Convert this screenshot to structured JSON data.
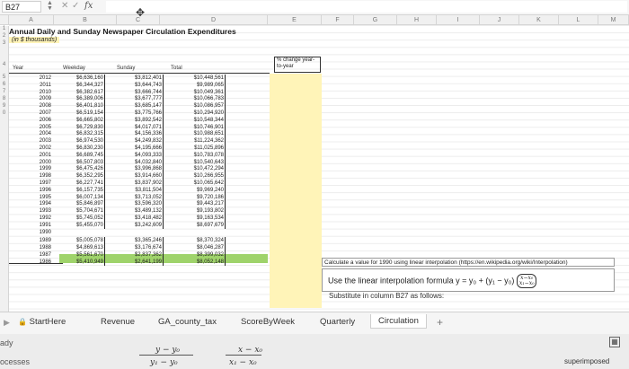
{
  "formula_bar": {
    "cell_ref": "B27",
    "fx": "fx",
    "cancel": "✕",
    "enter": "✓"
  },
  "columns": [
    "A",
    "B",
    "C",
    "D",
    "E",
    "F",
    "G",
    "H",
    "I",
    "J",
    "K",
    "L",
    "M"
  ],
  "rows": [
    "1",
    "2",
    "3",
    "4",
    "5",
    "6",
    "7",
    "8",
    "9",
    "0"
  ],
  "title": "Annual Daily and Sunday Newspaper Circulation Expenditures",
  "subtitle": "(in $ thousands)",
  "headers": {
    "year": "Year",
    "weekday": "Weekday",
    "sunday": "Sunday",
    "total": "Total",
    "pct": "% change year-to-year"
  },
  "table": [
    {
      "year": "2012",
      "weekday": "$6,636,160",
      "sunday": "$3,812,401",
      "total": "$10,448,561"
    },
    {
      "year": "2011",
      "weekday": "$6,344,327",
      "sunday": "$3,644,743",
      "total": "$9,989,065"
    },
    {
      "year": "2010",
      "weekday": "$6,382,617",
      "sunday": "$3,666,744",
      "total": "$10,049,361"
    },
    {
      "year": "2009",
      "weekday": "$6,389,006",
      "sunday": "$3,677,777",
      "total": "$10,066,783"
    },
    {
      "year": "2008",
      "weekday": "$6,401,810",
      "sunday": "$3,685,147",
      "total": "$10,086,957"
    },
    {
      "year": "2007",
      "weekday": "$6,519,154",
      "sunday": "$3,775,766",
      "total": "$10,294,920"
    },
    {
      "year": "2006",
      "weekday": "$6,665,802",
      "sunday": "$3,892,542",
      "total": "$10,548,344"
    },
    {
      "year": "2005",
      "weekday": "$6,729,830",
      "sunday": "$4,017,071",
      "total": "$10,746,901"
    },
    {
      "year": "2004",
      "weekday": "$6,832,315",
      "sunday": "$4,156,336",
      "total": "$10,988,651"
    },
    {
      "year": "2003",
      "weekday": "$6,974,530",
      "sunday": "$4,249,832",
      "total": "$11,224,362"
    },
    {
      "year": "2002",
      "weekday": "$6,830,230",
      "sunday": "$4,195,666",
      "total": "$11,025,896"
    },
    {
      "year": "2001",
      "weekday": "$6,689,745",
      "sunday": "$4,093,333",
      "total": "$10,783,078"
    },
    {
      "year": "2000",
      "weekday": "$6,507,803",
      "sunday": "$4,032,840",
      "total": "$10,540,643"
    },
    {
      "year": "1999",
      "weekday": "$6,475,426",
      "sunday": "$3,996,868",
      "total": "$10,472,294"
    },
    {
      "year": "1998",
      "weekday": "$6,352,295",
      "sunday": "$3,914,660",
      "total": "$10,266,955"
    },
    {
      "year": "1997",
      "weekday": "$6,227,741",
      "sunday": "$3,837,902",
      "total": "$10,065,642"
    },
    {
      "year": "1996",
      "weekday": "$6,157,735",
      "sunday": "$3,811,504",
      "total": "$9,969,240"
    },
    {
      "year": "1995",
      "weekday": "$6,007,134",
      "sunday": "$3,713,052",
      "total": "$9,720,186"
    },
    {
      "year": "1994",
      "weekday": "$5,846,897",
      "sunday": "$3,596,320",
      "total": "$9,443,217"
    },
    {
      "year": "1993",
      "weekday": "$5,704,671",
      "sunday": "$3,489,132",
      "total": "$9,193,802"
    },
    {
      "year": "1992",
      "weekday": "$5,745,052",
      "sunday": "$3,418,482",
      "total": "$9,163,534"
    },
    {
      "year": "1991",
      "weekday": "$5,455,070",
      "sunday": "$3,242,609",
      "total": "$8,697,679"
    },
    {
      "year": "1990",
      "weekday": "",
      "sunday": "",
      "total": ""
    },
    {
      "year": "1989",
      "weekday": "$5,005,078",
      "sunday": "$3,365,246",
      "total": "$8,370,324"
    },
    {
      "year": "1988",
      "weekday": "$4,869,613",
      "sunday": "$3,176,674",
      "total": "$8,046,287"
    },
    {
      "year": "1987",
      "weekday": "$5,561,670",
      "sunday": "$2,837,362",
      "total": "$8,399,032"
    },
    {
      "year": "1986",
      "weekday": "$5,410,949",
      "sunday": "$2,641,199",
      "total": "$8,052,148"
    }
  ],
  "notes": {
    "calc": "Calculate a value for 1990 using linear interpolation (https://en.wikipedia.org/wiki/Interpolation)",
    "formula_prefix": "Use the linear interpolation formula y = y₀ + (y₁ − y₀)",
    "frac_top": "x−x₀",
    "frac_bottom": "x₁−x₀",
    "substitute": "Substitute in column B27 as follows:"
  },
  "tabs": [
    {
      "label": "StartHere"
    },
    {
      "label": "Revenue"
    },
    {
      "label": "GA_county_tax"
    },
    {
      "label": "ScoreByWeek"
    },
    {
      "label": "Quarterly"
    },
    {
      "label": "Circulation"
    }
  ],
  "tab_add": "+",
  "status": {
    "ready": "ady",
    "processes": "ocesses",
    "right": "superimposed"
  },
  "overlay": {
    "lhs": "y − y₀",
    "rhs": "x − x₀",
    "d1": "y₁ − y₀",
    "d2": "x₁ − x₀"
  }
}
